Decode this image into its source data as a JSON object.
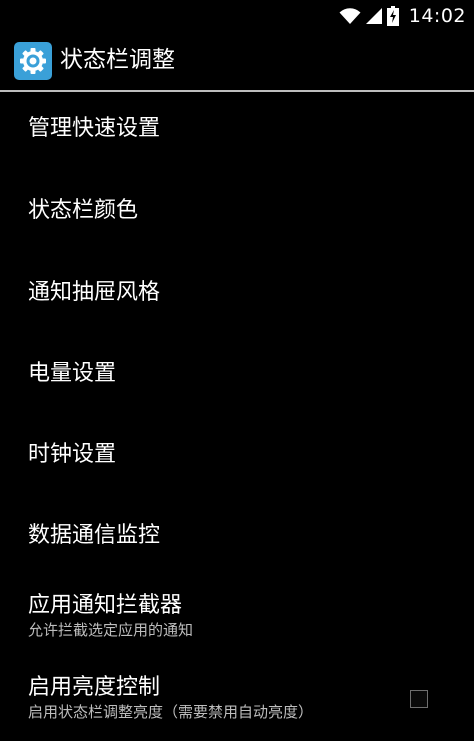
{
  "status_bar": {
    "time": "14:02",
    "icons": [
      "wifi-icon",
      "signal-icon",
      "battery-charging-icon"
    ]
  },
  "action_bar": {
    "icon": "settings-gear-icon",
    "title": "状态栏调整"
  },
  "colors": {
    "background": "#000000",
    "divider": "#bdbdbd",
    "text": "#ffffff",
    "summary_text": "#bdbdbd",
    "app_icon_bg": "#3aa0d8"
  },
  "preferences": [
    {
      "title": "管理快速设置"
    },
    {
      "title": "状态栏颜色"
    },
    {
      "title": "通知抽屉风格"
    },
    {
      "title": "电量设置"
    },
    {
      "title": "时钟设置"
    },
    {
      "title": "数据通信监控"
    },
    {
      "title": "应用通知拦截器",
      "summary": "允许拦截选定应用的通知"
    },
    {
      "title": "启用亮度控制",
      "summary": "启用状态栏调整亮度（需要禁用自动亮度）",
      "checked": false
    }
  ]
}
